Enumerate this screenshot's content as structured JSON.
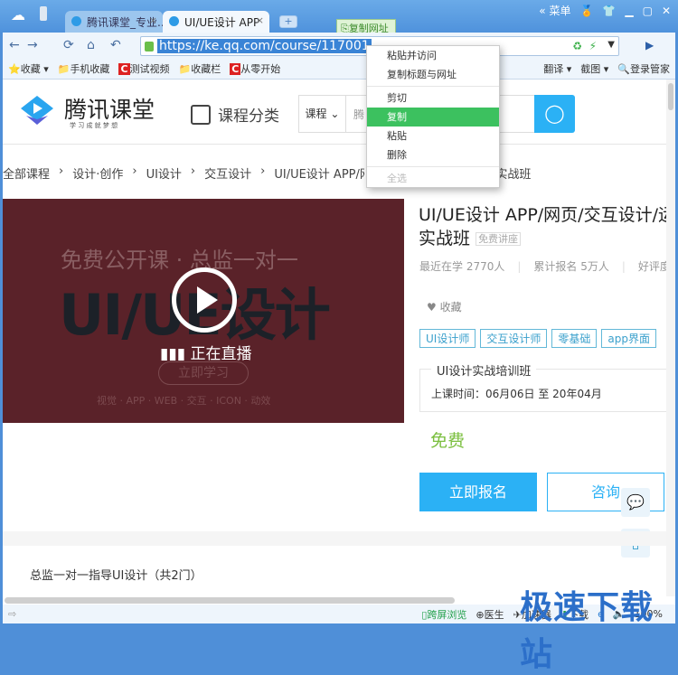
{
  "browser": {
    "tabs": [
      {
        "label": "腾讯课堂_专业..."
      },
      {
        "label": "UI/UE设计 APP"
      }
    ],
    "new_tab_label": "+",
    "tooltip": "复制网址",
    "menu_label": "« 菜单",
    "url": "https://ke.qq.com/course/117001",
    "bookmarks": [
      "收藏",
      "手机收藏",
      "测试视频",
      "收藏栏",
      "从零开始"
    ],
    "right_tools": [
      "翻译",
      "截图",
      "登录管家"
    ],
    "status_items": [
      "跨屏浏览",
      "医生",
      "加速器",
      "下载"
    ],
    "zoom": "100%"
  },
  "context_menu": {
    "items": [
      {
        "label": "粘贴并访问",
        "state": "normal"
      },
      {
        "label": "复制标题与网址",
        "state": "normal"
      },
      {
        "label": "剪切",
        "state": "normal"
      },
      {
        "label": "复制",
        "state": "selected"
      },
      {
        "label": "粘贴",
        "state": "normal"
      },
      {
        "label": "删除",
        "state": "normal"
      },
      {
        "label": "全选",
        "state": "disabled"
      }
    ]
  },
  "site": {
    "logo_title": "腾讯课堂",
    "logo_slogan": "学 习 成 就 梦 想",
    "category_label": "课程分类",
    "search_scope": "课程",
    "search_placeholder": "腾",
    "breadcrumb": [
      "全部课程",
      "设计·创作",
      "UI设计",
      "交互设计",
      "UI/UE设计 APP/网页/交互设计/运营设计实战班"
    ],
    "breadcrumb_tail": "实战班"
  },
  "video": {
    "banner_line1": "免费公开课 · 总监一对一",
    "banner_big": "UI/UE设计",
    "live_label": "正在直播",
    "learn_button": "立即学习",
    "tags_line": "视觉 · APP · WEB · 交互 · ICON · 动效"
  },
  "course": {
    "title_line1": "UI/UE设计 APP/网页/交互设计/运",
    "title_line2": "实战班",
    "badge": "免费讲座",
    "recent": "最近在学 2770人",
    "total": "累计报名 5万人",
    "rating": "好评度",
    "favorite": "收藏",
    "tags": [
      "UI设计师",
      "交互设计师",
      "零基础",
      "app界面"
    ],
    "class_name": "UI设计实战培训班",
    "schedule": "上课时间：06月06日 至 20年04月",
    "price": "免费",
    "enroll_button": "立即报名",
    "consult_button": "咨询"
  },
  "section": {
    "title": "总监一对一指导UI设计（共2门）"
  },
  "watermark": "极速下载站"
}
